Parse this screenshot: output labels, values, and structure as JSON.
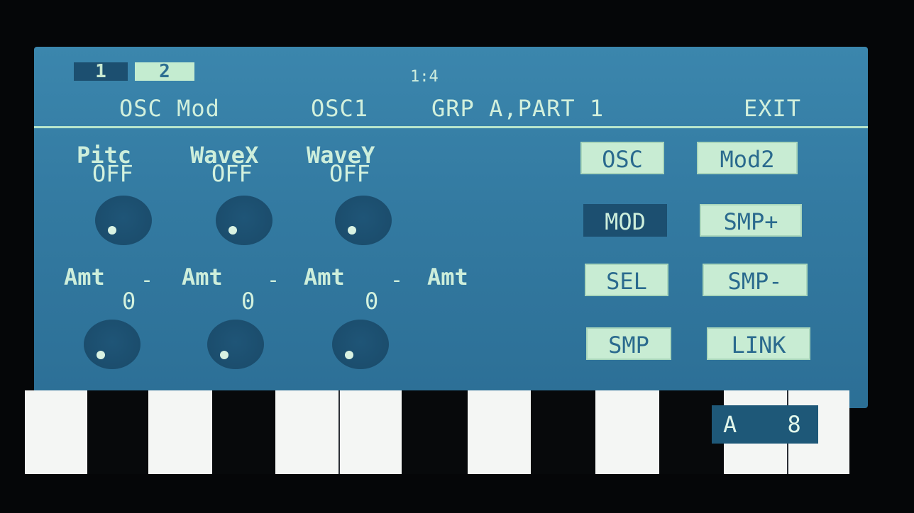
{
  "topbar": {
    "page_tabs": [
      "1",
      "2"
    ],
    "counter": "1:4"
  },
  "header": {
    "title": "OSC Mod",
    "osc": "OSC1",
    "group_part": "GRP A,PART 1",
    "exit": "EXIT"
  },
  "row1": [
    {
      "label": "Pitc",
      "value": "OFF"
    },
    {
      "label": "WaveX",
      "value": "OFF"
    },
    {
      "label": "WaveY",
      "value": "OFF"
    }
  ],
  "row2": [
    {
      "label": "Amt",
      "value": "0",
      "suffix": "-"
    },
    {
      "label": "Amt",
      "value": "0",
      "suffix": "-"
    },
    {
      "label": "Amt",
      "value": "0",
      "suffix": "-"
    },
    {
      "label": "Amt"
    }
  ],
  "buttons": {
    "osc": "OSC",
    "mod2": "Mod2",
    "mod": "MOD",
    "smp_plus": "SMP+",
    "sel": "SEL",
    "smp_minus": "SMP-",
    "smp": "SMP",
    "link": "LINK"
  },
  "note_display": {
    "octave_letter": "A",
    "value": "8"
  },
  "colors": {
    "screen": "#3380a7",
    "active": "#1c4f70",
    "button": "#c8ecd3",
    "text": "#cdeedb"
  }
}
